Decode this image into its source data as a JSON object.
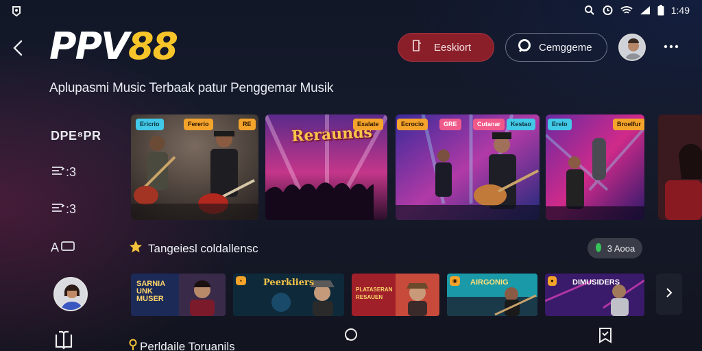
{
  "status_bar": {
    "time": "1:49",
    "icons": [
      "app-icon",
      "search-icon",
      "alarm-icon",
      "wifi-icon",
      "signal-icon",
      "battery-icon"
    ]
  },
  "header": {
    "logo_part1": "PPV",
    "logo_part2": "88",
    "tagline": "Aplupasmi Music Terbaak patur Penggemar Musik",
    "primary_button": "Eeskiort",
    "search_button": "Cemggeme",
    "colors": {
      "primary_button": "#8a1f2a",
      "logo_accent": "#f7c52a"
    }
  },
  "sidebar": {
    "title": "DPE⁸PR",
    "items": [
      {
        "icon": "playlist-icon",
        "label": ":3"
      },
      {
        "icon": "playlist-icon",
        "label": ":3"
      },
      {
        "icon": "screen-icon",
        "label": "A"
      }
    ]
  },
  "featured": [
    {
      "tags": [
        "Ericrio",
        "Fererio",
        "RE"
      ],
      "scene": "two-guitarists"
    },
    {
      "tags": [
        "Exalate"
      ],
      "title": "Reraunds",
      "scene": "concert-crowd"
    },
    {
      "tags": [
        "Ecrocio",
        "GRE",
        "Cutanar",
        "Kestao"
      ],
      "scene": "stage-band"
    },
    {
      "tags": [
        "Erelo",
        "Broelfur"
      ],
      "scene": "singer-stage"
    },
    {
      "tags": [],
      "scene": "singer-partial"
    }
  ],
  "section1": {
    "title": "Tangeiesl coldallensc",
    "pill_label": "3 Aooa"
  },
  "row2": [
    {
      "label": "SARNIA UNK MUSER"
    },
    {
      "label": "Peerkliers"
    },
    {
      "label": "PLATASERAN RESAUEN"
    },
    {
      "label": "AIRGONIG"
    },
    {
      "label": "DIMUSIDERS"
    }
  ],
  "section2": {
    "title": "Perldaile Toruanils"
  }
}
